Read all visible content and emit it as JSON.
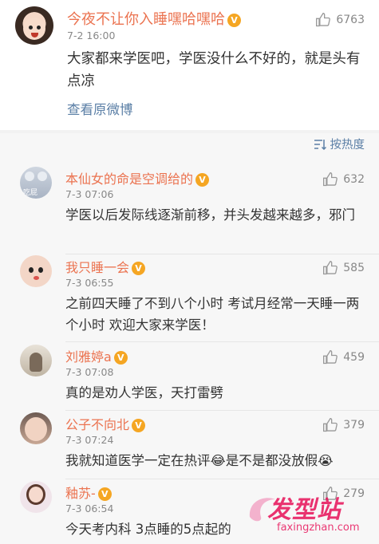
{
  "post": {
    "author": "今夜不让你入睡嘿哈嘿哈",
    "time": "7-2 16:00",
    "likes": "6763",
    "text": "大家都来学医吧，学医没什么不好的，就是头有点凉",
    "view_original": "查看原微博"
  },
  "comments_header": {
    "sort_label": "按热度"
  },
  "comments": [
    {
      "name": "本仙女的命是空调给的",
      "time": "7-3 07:06",
      "likes": "632",
      "text": "学医以后发际线逐渐前移，并头发越来越多，邪门",
      "avatar_text": "吃屁"
    },
    {
      "name": "我只睡一会",
      "time": "7-3 06:55",
      "likes": "585",
      "text": "之前四天睡了不到八个小时 考试月经常一天睡一两个小时 欢迎大家来学医！"
    },
    {
      "name": "刘雅婷a",
      "time": "7-3 07:08",
      "likes": "459",
      "text": "真的是劝人学医，天打雷劈"
    },
    {
      "name": "公子不向北",
      "time": "7-3 07:24",
      "likes": "379",
      "text": "我就知道医学一定在热评😂是不是都没放假😭"
    },
    {
      "name": "釉苏-",
      "time": "7-3 06:54",
      "likes": "279",
      "text": "今天考内科 3点睡的5点起的"
    }
  ],
  "watermark": {
    "logo": "发型站",
    "url": "faxingzhan.com"
  },
  "colors": {
    "name": "#eb7350",
    "link": "#5b7fa6",
    "muted": "#888888",
    "watermark": "#e8175d"
  },
  "icons": [
    "thumbs-up-icon",
    "sort-icon",
    "vip-badge-icon"
  ]
}
